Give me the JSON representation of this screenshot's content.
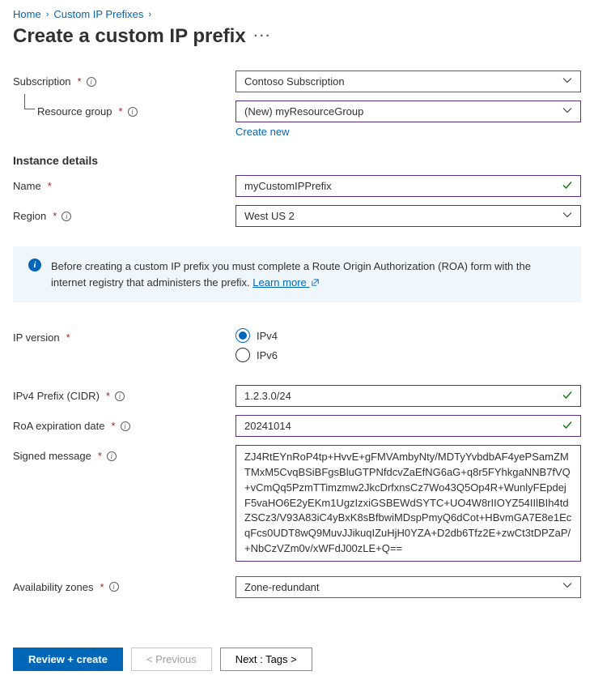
{
  "breadcrumb": {
    "home": "Home",
    "prefixes": "Custom IP Prefixes"
  },
  "page": {
    "title": "Create a custom IP prefix"
  },
  "labels": {
    "subscription": "Subscription",
    "resource_group": "Resource group",
    "instance_details": "Instance details",
    "name": "Name",
    "region": "Region",
    "ip_version": "IP version",
    "ipv4_prefix": "IPv4 Prefix (CIDR)",
    "roa_exp": "RoA expiration date",
    "signed_msg": "Signed message",
    "avail_zones": "Availability zones"
  },
  "values": {
    "subscription": "Contoso Subscription",
    "resource_group": "(New) myResourceGroup",
    "create_new": "Create new",
    "name": "myCustomIPPrefix",
    "region": "West US 2",
    "ipv4": "IPv4",
    "ipv6": "IPv6",
    "ipv4_prefix": "1.2.3.0/24",
    "roa_exp": "20241014",
    "signed_msg": "ZJ4RtEYnRoP4tp+HvvE+gFMVAmbyNty/MDTyYvbdbAF4yePSamZMTMxM5CvqBSiBFgsBluGTPNfdcvZaEfNG6aG+q8r5FYhkgaNNB7fVQ+vCmQq5PzmTTimzmw2JkcDrfxnsCz7Wo43Q5Op4R+WunlyFEpdejF5vaHO6E2yEKm1UgzIzxiGSBEWdSYTC+UO4W8rIIOYZ54IIlBIh4tdZSCz3/V93A83iC4yBxK8sBfbwiMDspPmyQ6dCot+HBvmGA7E8e1EcqFcs0UDT8wQ9MuvJJikuqIZuHjH0YZA+D2db6Tfz2E+zwCt3tDPZaP/+NbCzVZm0v/xWFdJ00zLE+Q==",
    "avail_zones": "Zone-redundant"
  },
  "banner": {
    "text": "Before creating a custom IP prefix you must complete a Route Origin Authorization (ROA) form with the internet registry that administers the prefix. ",
    "learn_more": "Learn more"
  },
  "footer": {
    "review": "Review + create",
    "previous": "< Previous",
    "next": "Next : Tags >"
  }
}
